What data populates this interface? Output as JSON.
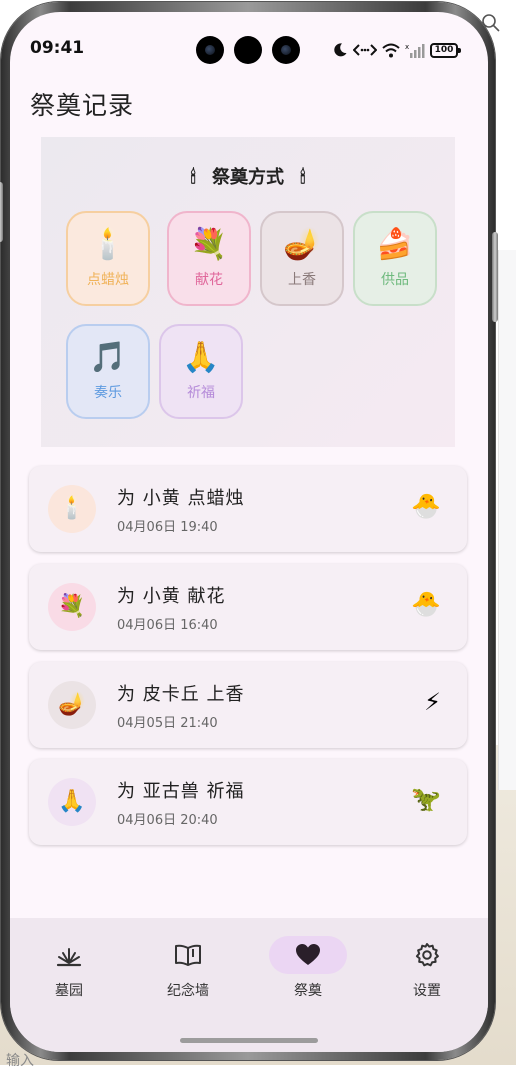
{
  "background": {
    "bottom_text": "输入"
  },
  "status_bar": {
    "time": "09:41",
    "battery": "100"
  },
  "page_title": "祭奠记录",
  "methods": {
    "title": "祭奠方式",
    "title_icon": "🕯",
    "items": [
      {
        "label": "点蜡烛",
        "emoji": "🕯️",
        "color": "#f0b35a",
        "bg": "#fbe9de",
        "border": "#f6cfa0"
      },
      {
        "label": "献花",
        "emoji": "💐",
        "color": "#e0679b",
        "bg": "#f9dfea",
        "border": "#f0b5cc"
      },
      {
        "label": "上香",
        "emoji": "🪔",
        "color": "#8a7a7a",
        "bg": "#ece3e6",
        "border": "#d5c7cb"
      },
      {
        "label": "供品",
        "emoji": "🍰",
        "color": "#6fba7e",
        "bg": "#e6efe6",
        "border": "#c8dfc9"
      },
      {
        "label": "奏乐",
        "emoji": "🎵",
        "color": "#5f9be0",
        "bg": "#e3e7f6",
        "border": "#b9cdef"
      },
      {
        "label": "祈福",
        "emoji": "🙏",
        "color": "#b58bd9",
        "bg": "#efe3f4",
        "border": "#dcc6ea"
      }
    ]
  },
  "records": [
    {
      "title": "为 小黄 点蜡烛",
      "time": "04月06日 19:40",
      "icon": "🕯️",
      "icon_bg": "#fbe6dc",
      "pet_icon": "🐣"
    },
    {
      "title": "为 小黄 献花",
      "time": "04月06日 16:40",
      "icon": "💐",
      "icon_bg": "#f9dbe6",
      "pet_icon": "🐣"
    },
    {
      "title": "为 皮卡丘 上香",
      "time": "04月05日 21:40",
      "icon": "🪔",
      "icon_bg": "#ebe3e5",
      "pet_icon": "⚡"
    },
    {
      "title": "为 亚古兽 祈福",
      "time": "04月06日 20:40",
      "icon": "🙏",
      "icon_bg": "#f0e2f3",
      "pet_icon": "🦖"
    }
  ],
  "bottom_nav": {
    "active": "祭奠",
    "items": [
      {
        "label": "墓园",
        "icon": "grass-icon"
      },
      {
        "label": "纪念墙",
        "icon": "book-icon"
      },
      {
        "label": "祭奠",
        "icon": "heart-icon"
      },
      {
        "label": "设置",
        "icon": "gear-icon"
      }
    ]
  }
}
